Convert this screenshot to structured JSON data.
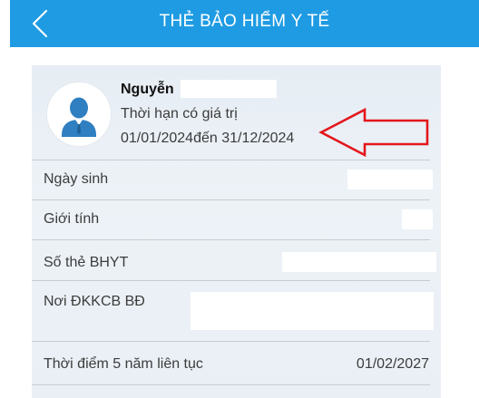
{
  "header": {
    "title": "THẺ BẢO HIỂM Y TẾ",
    "back_icon": "chevron-left-icon",
    "background": "#1e9be3"
  },
  "card": {
    "avatar_icon": "user-avatar-icon",
    "name": "Nguyễn",
    "validity_label": "Thời hạn có giá trị",
    "validity_range": "01/01/2024đến 31/12/2024",
    "annotation_arrow_color": "#e3161c",
    "rows": [
      {
        "label": "Ngày sinh",
        "value": ""
      },
      {
        "label": "Giới tính",
        "value": ""
      },
      {
        "label": "Số thẻ BHYT",
        "value": ""
      },
      {
        "label": "Nơi ĐKKCB BĐ",
        "value": ""
      },
      {
        "label": "Thời điểm 5 năm liên tục",
        "value": "01/02/2027"
      }
    ]
  }
}
